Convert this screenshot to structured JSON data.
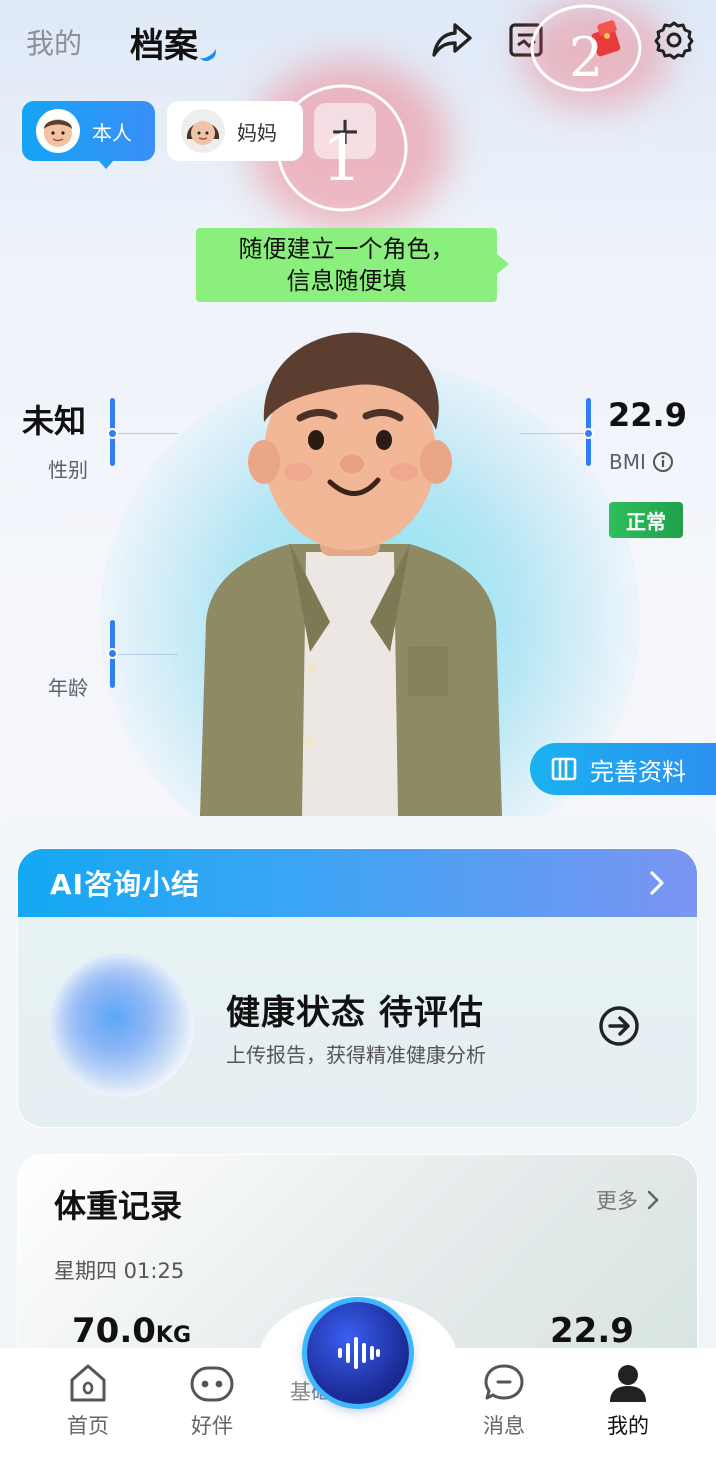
{
  "header": {
    "tab_mine": "我的",
    "tab_profile": "档案"
  },
  "members": {
    "self_label": "本人",
    "mom_label": "妈妈",
    "add_label": "+"
  },
  "annotations": {
    "mark1": "1",
    "mark2": "2"
  },
  "tooltip": {
    "line1": "随便建立一个角色，",
    "line2": "信息随便填"
  },
  "stats": {
    "gender_value": "未知",
    "gender_label": "性别",
    "age_label": "年龄",
    "bmi_value": "22.9",
    "bmi_label": "BMI",
    "bmi_status": "正常"
  },
  "complete_profile": "完善资料",
  "ai_summary": {
    "title": "AI咨询小结",
    "status": "健康状态 待评估",
    "subtitle": "上传报告，获得精准健康分析"
  },
  "weight_record": {
    "title": "体重记录",
    "more": "更多",
    "date": "星期四 01:25",
    "weight_value": "70.0",
    "weight_unit": "KG",
    "bmi_value": "22.9",
    "hidden_label": "基础代谢率"
  },
  "nav": {
    "home": "首页",
    "buddy": "好伴",
    "messages": "消息",
    "mine": "我的"
  },
  "colors": {
    "accent_blue": "#1a8df0",
    "normal_green": "#22a34c",
    "tooltip_green": "#8bef7d"
  }
}
